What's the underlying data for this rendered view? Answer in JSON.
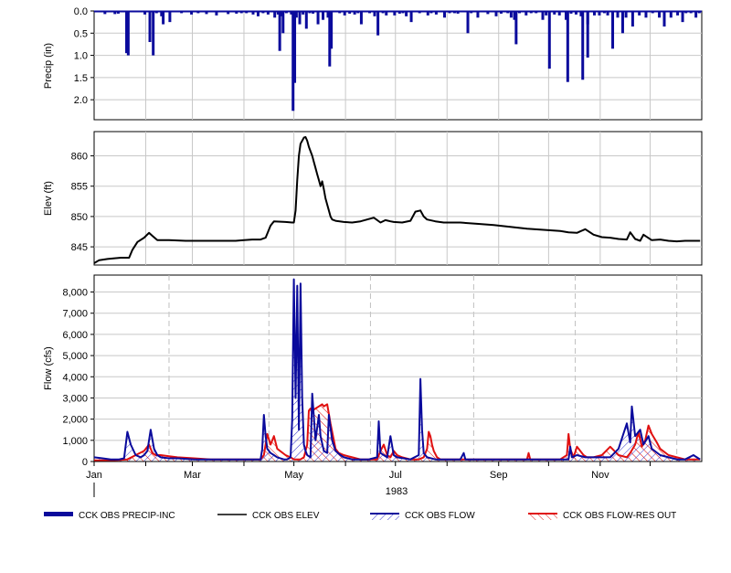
{
  "chart_data": [
    {
      "type": "bar",
      "ylabel": "Precip (in)",
      "ylim": [
        0,
        2.45
      ],
      "y_inverted": true,
      "yticks": [
        "0.0",
        "0.5",
        "1.0",
        "1.5",
        "2.0"
      ],
      "grid": true,
      "color": "#0a0a9c",
      "series": [
        {
          "name": "CCK OBS PRECIP-INC",
          "x": [
            6,
            12,
            14,
            30,
            33,
            35,
            37,
            40,
            41,
            45,
            52,
            58,
            62,
            67,
            73,
            80,
            85,
            88,
            91,
            95,
            98,
            101,
            104,
            108,
            110,
            111,
            112,
            113,
            115,
            118,
            121,
            123,
            125,
            127,
            129,
            131,
            134,
            137,
            140,
            142,
            147,
            150,
            153,
            156,
            158,
            160,
            165,
            168,
            170,
            173,
            175,
            180,
            183,
            185,
            187,
            190,
            195,
            200,
            202,
            205,
            210,
            213,
            216,
            218,
            224,
            226,
            230,
            236,
            241,
            244,
            248,
            250,
            255,
            259,
            262,
            265,
            269,
            271,
            273,
            276,
            279,
            283,
            286,
            289,
            292,
            296,
            300,
            303,
            306,
            308,
            311,
            314,
            317,
            319,
            323,
            327,
            331,
            335,
            339,
            342,
            346,
            350,
            353,
            355,
            358,
            361,
            363
          ],
          "values": [
            0.07,
            0.07,
            0.06,
            0.08,
            0.7,
            1.0,
            0.05,
            0.12,
            0.3,
            0.25,
            0.05,
            0.08,
            0.05,
            0.07,
            0.1,
            0.07,
            0.06,
            0.05,
            0.05,
            0.08,
            0.12,
            0.05,
            0.08,
            0.15,
            0.08,
            0.9,
            0.12,
            0.5,
            0.05,
            0.06,
            0.15,
            0.3,
            0.08,
            0.4,
            0.05,
            0.06,
            0.3,
            0.2,
            0.15,
            0.85,
            0.05,
            0.1,
            0.06,
            0.08,
            0.05,
            0.3,
            0.05,
            0.12,
            0.55,
            0.05,
            0.1,
            0.1,
            0.06,
            0.05,
            0.12,
            0.25,
            0.05,
            0.1,
            0.05,
            0.08,
            0.15,
            0.05,
            0.05,
            0.06,
            0.5,
            0.05,
            0.15,
            0.07,
            0.12,
            0.06,
            0.05,
            0.15,
            0.05,
            0.1,
            0.05,
            0.05,
            0.2,
            0.1,
            1.3,
            0.08,
            0.1,
            0.2,
            0.06,
            0.08,
            0.12,
            0.3,
            0.1,
            0.1,
            0.05,
            0.1,
            0.85,
            0.15,
            0.5,
            0.15,
            0.35,
            0.1,
            0.15,
            0.05,
            0.15,
            0.35,
            0.15,
            0.1,
            0.25,
            0.05,
            0.05,
            0.15,
            0.05
          ],
          "x_units": "day of 1983",
          "extra_bars": [
            {
              "x": 19,
              "value": 0.95
            },
            {
              "x": 20,
              "value": 1.0
            },
            {
              "x": 118,
              "value": 0.08
            },
            {
              "x": 119,
              "value": 2.25
            },
            {
              "x": 120,
              "value": 1.62
            },
            {
              "x": 141,
              "value": 1.25
            },
            {
              "x": 252,
              "value": 0.2
            },
            {
              "x": 253,
              "value": 0.75
            },
            {
              "x": 284,
              "value": 1.6
            },
            {
              "x": 293,
              "value": 1.55
            },
            {
              "x": 296,
              "value": 1.05
            }
          ]
        }
      ]
    },
    {
      "type": "line",
      "ylabel": "Elev (ft)",
      "ylim": [
        842,
        864
      ],
      "yticks": [
        "845",
        "850",
        "855",
        "860"
      ],
      "grid": true,
      "series": [
        {
          "name": "CCK OBS ELEV",
          "color": "#000000",
          "x": [
            0,
            3,
            8,
            16,
            21,
            23,
            26,
            30,
            33,
            35,
            38,
            45,
            55,
            70,
            85,
            90,
            95,
            98,
            100,
            103,
            106,
            108,
            115,
            119,
            120,
            121,
            122,
            123,
            124,
            126,
            127,
            128,
            129,
            131,
            132,
            133,
            134,
            135,
            136,
            137,
            138,
            139,
            141,
            142,
            143,
            145,
            150,
            155,
            160,
            168,
            172,
            175,
            178,
            180,
            185,
            190,
            193,
            196,
            198,
            200,
            205,
            210,
            220,
            230,
            240,
            250,
            260,
            270,
            280,
            285,
            290,
            295,
            300,
            305,
            310,
            315,
            320,
            322,
            325,
            328,
            330,
            335,
            340,
            345,
            350,
            355,
            360,
            364
          ],
          "values": [
            842.3,
            842.8,
            843.0,
            843.2,
            843.2,
            844.5,
            845.8,
            846.5,
            847.3,
            846.8,
            846.1,
            846.1,
            846.0,
            846.0,
            846.0,
            846.1,
            846.2,
            846.2,
            846.2,
            846.5,
            848.5,
            849.2,
            849.1,
            849.0,
            849.0,
            851.0,
            856.0,
            860.0,
            862.0,
            863.0,
            863.1,
            862.5,
            861.5,
            860.0,
            859.0,
            858.0,
            857.0,
            856.0,
            855.0,
            855.8,
            854.5,
            853.0,
            851.0,
            850.0,
            849.5,
            849.3,
            849.1,
            849.0,
            849.2,
            849.8,
            849.0,
            849.4,
            849.2,
            849.1,
            849.0,
            849.3,
            850.8,
            851.0,
            850.0,
            849.5,
            849.2,
            849.0,
            849.0,
            848.8,
            848.6,
            848.3,
            848.0,
            847.8,
            847.6,
            847.4,
            847.3,
            847.9,
            847.0,
            846.6,
            846.5,
            846.3,
            846.2,
            847.4,
            846.3,
            846.0,
            847.0,
            846.1,
            846.2,
            846.0,
            845.9,
            846.0,
            846.0,
            846.0
          ]
        }
      ]
    },
    {
      "type": "area",
      "ylabel": "Flow (cfs)",
      "ylim": [
        0,
        8800
      ],
      "yticks": [
        "0",
        "1,000",
        "2,000",
        "3,000",
        "4,000",
        "5,000",
        "6,000",
        "7,000",
        "8,000"
      ],
      "xlabel": "1983",
      "xticks": [
        "Jan",
        "Mar",
        "May",
        "Jul",
        "Sep",
        "Nov"
      ],
      "xtick_days": [
        0,
        59,
        120,
        181,
        243,
        304
      ],
      "grid": true,
      "series": [
        {
          "name": "CCK OBS FLOW",
          "color": "#0a0a9c",
          "hatch": "#3333cc",
          "x": [
            0,
            5,
            10,
            15,
            18,
            20,
            22,
            25,
            28,
            30,
            32,
            34,
            36,
            38,
            40,
            45,
            50,
            60,
            70,
            80,
            90,
            95,
            100,
            101,
            102,
            103,
            104,
            105,
            106,
            108,
            110,
            114,
            116,
            118,
            119,
            120,
            121,
            122,
            123,
            124,
            125,
            126,
            127,
            128,
            130,
            131,
            133,
            135,
            136,
            138,
            140,
            141,
            143,
            145,
            148,
            150,
            155,
            160,
            165,
            170,
            171,
            172,
            174,
            176,
            178,
            180,
            182,
            190,
            195,
            196,
            197,
            198,
            200,
            205,
            210,
            215,
            220,
            222,
            223,
            224,
            230,
            240,
            250,
            260,
            270,
            280,
            285,
            286,
            287,
            290,
            295,
            300,
            305,
            310,
            315,
            320,
            322,
            323,
            325,
            328,
            330,
            333,
            335,
            340,
            345,
            350,
            355,
            360,
            364
          ],
          "values": [
            200,
            150,
            100,
            100,
            150,
            1400,
            800,
            300,
            200,
            300,
            500,
            1500,
            600,
            300,
            200,
            150,
            150,
            100,
            100,
            100,
            100,
            100,
            100,
            600,
            2200,
            1200,
            600,
            500,
            400,
            300,
            200,
            100,
            100,
            200,
            2000,
            8600,
            3000,
            8300,
            1500,
            8400,
            3000,
            800,
            500,
            300,
            200,
            3200,
            1000,
            2200,
            1200,
            500,
            400,
            2200,
            1000,
            500,
            300,
            200,
            100,
            100,
            100,
            200,
            1900,
            400,
            300,
            200,
            1200,
            300,
            200,
            100,
            300,
            3900,
            1500,
            400,
            200,
            100,
            100,
            100,
            100,
            400,
            100,
            100,
            100,
            100,
            100,
            100,
            100,
            100,
            100,
            700,
            200,
            300,
            200,
            200,
            200,
            200,
            600,
            1800,
            900,
            2600,
            1200,
            1500,
            800,
            1200,
            600,
            300,
            200,
            100,
            100,
            300,
            100
          ]
        },
        {
          "name": "CCK OBS FLOW-RES OUT",
          "color": "#e01010",
          "hatch": "#e01010",
          "x": [
            0,
            10,
            20,
            25,
            30,
            33,
            35,
            37,
            40,
            45,
            50,
            60,
            70,
            80,
            90,
            100,
            102,
            104,
            106,
            108,
            110,
            115,
            118,
            120,
            122,
            124,
            126,
            128,
            129,
            130,
            131,
            133,
            135,
            137,
            138,
            140,
            142,
            144,
            145,
            147,
            150,
            155,
            160,
            165,
            170,
            172,
            174,
            176,
            178,
            180,
            182,
            185,
            190,
            195,
            198,
            200,
            201,
            202,
            203,
            204,
            206,
            208,
            210,
            220,
            230,
            240,
            260,
            261,
            262,
            270,
            280,
            284,
            285,
            286,
            288,
            290,
            294,
            296,
            300,
            305,
            310,
            315,
            320,
            322,
            325,
            327,
            329,
            331,
            333,
            335,
            338,
            340,
            345,
            350,
            355,
            360,
            364
          ],
          "values": [
            50,
            50,
            100,
            300,
            500,
            800,
            400,
            300,
            300,
            250,
            200,
            150,
            100,
            100,
            100,
            100,
            300,
            1300,
            800,
            1200,
            600,
            300,
            200,
            100,
            100,
            100,
            200,
            800,
            2400,
            2500,
            2400,
            2500,
            2600,
            2700,
            2600,
            2700,
            1800,
            1000,
            600,
            400,
            300,
            200,
            100,
            100,
            100,
            500,
            800,
            300,
            200,
            500,
            300,
            200,
            100,
            100,
            200,
            600,
            1400,
            1200,
            800,
            500,
            200,
            100,
            100,
            100,
            100,
            100,
            100,
            400,
            100,
            100,
            100,
            300,
            1300,
            600,
            200,
            700,
            300,
            200,
            200,
            300,
            700,
            300,
            200,
            400,
            800,
            1400,
            700,
            1000,
            1700,
            1300,
            900,
            600,
            300,
            200,
            100,
            100,
            100
          ]
        }
      ]
    }
  ],
  "legend": {
    "items": [
      {
        "label": "CCK OBS PRECIP-INC",
        "color": "#0a0a9c",
        "style": "thick-bar"
      },
      {
        "label": "CCK OBS ELEV",
        "color": "#000000",
        "style": "line"
      },
      {
        "label": "CCK OBS FLOW",
        "color": "#0a0a9c",
        "style": "hatched"
      },
      {
        "label": "CCK OBS FLOW-RES OUT",
        "color": "#e01010",
        "style": "hatched"
      }
    ]
  }
}
